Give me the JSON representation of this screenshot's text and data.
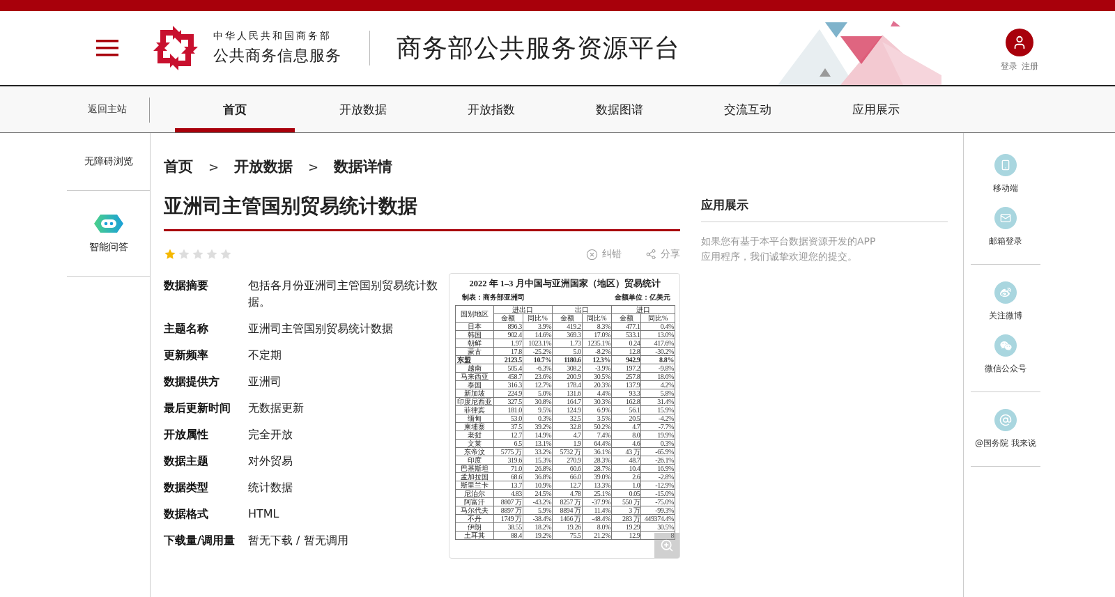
{
  "header": {
    "logo_small": "中华人民共和国商务部",
    "logo_big": "公共商务信息服务",
    "title": "商务部公共服务资源平台",
    "login": "登录",
    "register": "注册"
  },
  "nav": {
    "back": "返回主站",
    "tabs": [
      {
        "label": "首页",
        "selected": true
      },
      {
        "label": "开放数据",
        "selected": false
      },
      {
        "label": "开放指数",
        "selected": false
      },
      {
        "label": "数据图谱",
        "selected": false
      },
      {
        "label": "交流互动",
        "selected": false
      },
      {
        "label": "应用展示",
        "selected": false
      }
    ]
  },
  "left_sidebar": {
    "items": [
      {
        "label": "无障碍浏览",
        "kind": "text"
      },
      {
        "label": "智能问答",
        "kind": "bot"
      }
    ]
  },
  "breadcrumb": {
    "items": [
      "首页",
      "开放数据",
      "数据详情"
    ],
    "separators": [
      ">",
      ">"
    ]
  },
  "dataset": {
    "title": "亚洲司主管国别贸易统计数据",
    "stars": 1,
    "actions": [
      {
        "label": "纠错",
        "kind": "report"
      },
      {
        "label": "分享",
        "kind": "share"
      }
    ],
    "fields": [
      {
        "label": "数据摘要",
        "value": "包括各月份亚洲司主管国别贸易统计数据。"
      },
      {
        "label": "主题名称",
        "value": "亚洲司主管国别贸易统计数据"
      },
      {
        "label": "更新频率",
        "value": "不定期"
      },
      {
        "label": "数据提供方",
        "value": "亚洲司"
      },
      {
        "label": "最后更新时间",
        "value": "无数据更新"
      },
      {
        "label": "开放属性",
        "value": "完全开放"
      },
      {
        "label": "数据主题",
        "value": "对外贸易"
      },
      {
        "label": "数据类型",
        "value": "统计数据"
      },
      {
        "label": "数据格式",
        "value": "HTML"
      },
      {
        "label": "下载量/调用量",
        "value": "暂无下载 / 暂无调用"
      }
    ],
    "preview": {
      "title": "2022 年 1–3 月中国与亚洲国家（地区）贸易统计",
      "maker": "制表：商务部亚洲司",
      "unit": "金额单位：亿美元",
      "region_header": "国别地区",
      "groups": [
        "进出口",
        "出口",
        "进口"
      ],
      "subheaders": [
        "金额",
        "同比%",
        "金额",
        "同比%",
        "金额",
        "同比%"
      ],
      "rows": [
        {
          "name": "日本",
          "kind": "country",
          "cells": [
            "896.3",
            "3.9%",
            "419.2",
            "8.3%",
            "477.1",
            "0.4%"
          ]
        },
        {
          "name": "韩国",
          "kind": "country",
          "cells": [
            "902.4",
            "14.6%",
            "369.3",
            "17.0%",
            "533.1",
            "13.0%"
          ]
        },
        {
          "name": "朝鲜",
          "kind": "country",
          "cells": [
            "1.97",
            "1023.1%",
            "1.73",
            "1235.1%",
            "0.24",
            "417.6%"
          ]
        },
        {
          "name": "蒙古",
          "kind": "country",
          "cells": [
            "17.8",
            "-25.2%",
            "5.0",
            "-8.2%",
            "12.8",
            "-30.2%"
          ]
        },
        {
          "name": "东盟",
          "kind": "group",
          "cells": [
            "2123.5",
            "10.7%",
            "1180.6",
            "12.3%",
            "942.9",
            "8.8%"
          ]
        },
        {
          "name": "越南",
          "kind": "country",
          "cells": [
            "505.4",
            "-6.3%",
            "308.2",
            "-3.9%",
            "197.2",
            "-9.8%"
          ]
        },
        {
          "name": "马来西亚",
          "kind": "country",
          "cells": [
            "458.7",
            "23.6%",
            "200.9",
            "30.5%",
            "257.8",
            "18.6%"
          ]
        },
        {
          "name": "泰国",
          "kind": "country",
          "cells": [
            "316.3",
            "12.7%",
            "178.4",
            "20.3%",
            "137.9",
            "4.2%"
          ]
        },
        {
          "name": "新加坡",
          "kind": "country",
          "cells": [
            "224.9",
            "5.0%",
            "131.6",
            "4.4%",
            "93.3",
            "5.8%"
          ]
        },
        {
          "name": "印度尼西亚",
          "kind": "country",
          "cells": [
            "327.5",
            "30.8%",
            "164.7",
            "30.3%",
            "162.8",
            "31.4%"
          ]
        },
        {
          "name": "菲律宾",
          "kind": "country",
          "cells": [
            "181.0",
            "9.5%",
            "124.9",
            "6.9%",
            "56.1",
            "15.9%"
          ]
        },
        {
          "name": "缅甸",
          "kind": "country",
          "cells": [
            "53.0",
            "0.3%",
            "32.5",
            "3.5%",
            "20.5",
            "-4.2%"
          ]
        },
        {
          "name": "柬埔寨",
          "kind": "country",
          "cells": [
            "37.5",
            "39.2%",
            "32.8",
            "50.2%",
            "4.7",
            "-7.7%"
          ]
        },
        {
          "name": "老挝",
          "kind": "country",
          "cells": [
            "12.7",
            "14.9%",
            "4.7",
            "7.4%",
            "8.0",
            "19.9%"
          ]
        },
        {
          "name": "文莱",
          "kind": "country",
          "cells": [
            "6.5",
            "13.1%",
            "1.9",
            "64.4%",
            "4.6",
            "0.3%"
          ]
        },
        {
          "name": "东帝汶",
          "kind": "country",
          "cells": [
            "5775 万",
            "33.2%",
            "5732 万",
            "36.1%",
            "43 万",
            "-65.9%"
          ]
        },
        {
          "name": "印度",
          "kind": "country",
          "cells": [
            "319.6",
            "15.3%",
            "270.9",
            "28.3%",
            "48.7",
            "-26.1%"
          ]
        },
        {
          "name": "巴基斯坦",
          "kind": "country",
          "cells": [
            "71.0",
            "26.8%",
            "60.6",
            "28.7%",
            "10.4",
            "16.9%"
          ]
        },
        {
          "name": "孟加拉国",
          "kind": "country",
          "cells": [
            "68.6",
            "36.8%",
            "66.0",
            "39.0%",
            "2.6",
            "-2.8%"
          ]
        },
        {
          "name": "斯里兰卡",
          "kind": "country",
          "cells": [
            "13.7",
            "10.9%",
            "12.7",
            "13.3%",
            "1.0",
            "-12.9%"
          ]
        },
        {
          "name": "尼泊尔",
          "kind": "country",
          "cells": [
            "4.83",
            "24.5%",
            "4.78",
            "25.1%",
            "0.05",
            "-15.0%"
          ]
        },
        {
          "name": "阿富汗",
          "kind": "country",
          "cells": [
            "8807 万",
            "-43.2%",
            "8257 万",
            "-37.9%",
            "550 万",
            "-75.0%"
          ]
        },
        {
          "name": "马尔代夫",
          "kind": "country",
          "cells": [
            "8897 万",
            "5.9%",
            "8894 万",
            "11.4%",
            "3 万",
            "-99.3%"
          ]
        },
        {
          "name": "不丹",
          "kind": "country",
          "cells": [
            "1749 万",
            "-38.4%",
            "1466 万",
            "-48.4%",
            "283 万",
            "449374.4%"
          ]
        },
        {
          "name": "伊朗",
          "kind": "country",
          "cells": [
            "38.55",
            "18.2%",
            "19.26",
            "8.0%",
            "19.29",
            "30.5%"
          ]
        },
        {
          "name": "土耳其",
          "kind": "country",
          "cells": [
            "88.4",
            "19.2%",
            "75.5",
            "21.2%",
            "12.9",
            "8"
          ]
        }
      ]
    }
  },
  "app_showcase": {
    "title": "应用展示",
    "text": "如果您有基于本平台数据资源开发的APP应用程序，我们诚挚欢迎您的提交。"
  },
  "right_sidebar": {
    "groups": [
      {
        "items": [
          {
            "label": "移动端",
            "kind": "mobile"
          },
          {
            "label": "邮箱登录",
            "kind": "mail"
          }
        ]
      },
      {
        "items": [
          {
            "label": "关注微博",
            "kind": "weibo"
          },
          {
            "label": "微信公众号",
            "kind": "wechat"
          }
        ]
      },
      {
        "items": [
          {
            "label": "@国务院 我来说",
            "kind": "at"
          }
        ]
      }
    ]
  }
}
